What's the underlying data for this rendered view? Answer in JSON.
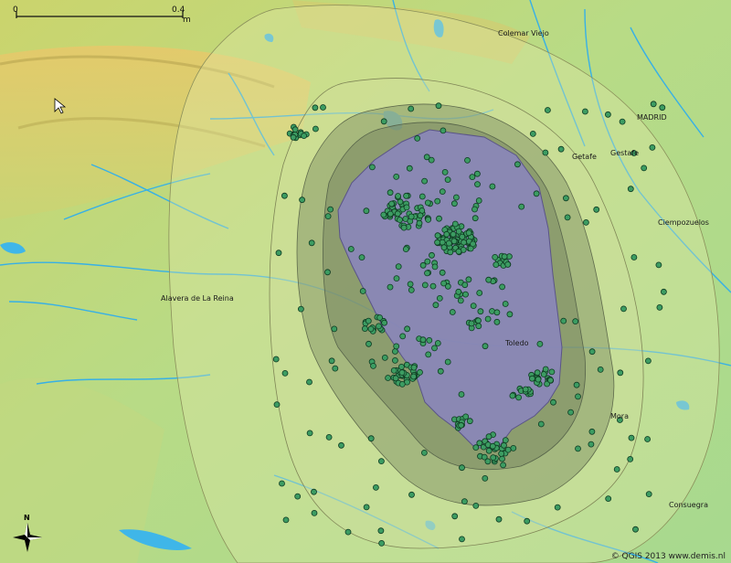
{
  "scale_bar": {
    "start_label": "0",
    "end_label": "0.4",
    "unit": "m"
  },
  "places": {
    "colmenar_viejo": "Colemar Viejo",
    "madrid": "MADRID",
    "getafe_1": "Getafe",
    "getafe_2": "Gestafe",
    "ciempozuelos": "Ciempozuelos",
    "talavera": "Alavera de La Reina",
    "toledo": "Toledo",
    "mora": "Mora",
    "consuegra": "Consuegra"
  },
  "north_arrow": {
    "label": "N"
  },
  "attribution": "© QGIS 2013 www.demis.nl",
  "colors": {
    "terrain_low": "#a9d886",
    "terrain_high": "#e0c96a",
    "water": "#3fb6e8",
    "buffer_outer": "#d8e6a2",
    "buffer_mid": "#8c9a6a",
    "core_polygon": "#8a84c0",
    "point_fill": "#3c9c62",
    "point_stroke": "#0e3b22"
  },
  "legend_icons": [
    "north-arrow-icon",
    "cursor-icon"
  ]
}
